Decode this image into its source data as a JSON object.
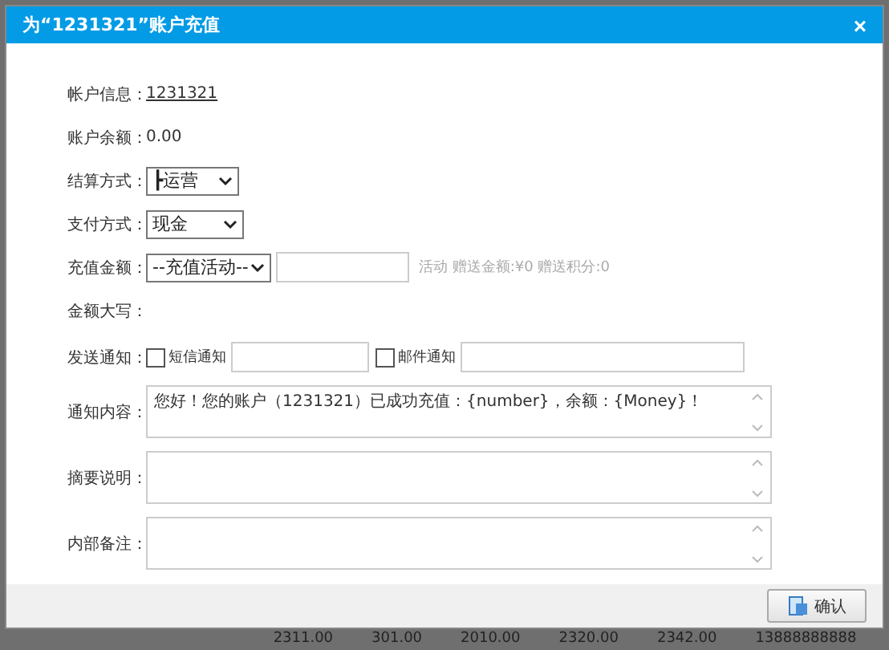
{
  "dialog": {
    "title": "为“1231321”账户充值",
    "close": "×"
  },
  "form": {
    "account_info": {
      "label": "帐户信息：",
      "value": "1231321"
    },
    "balance": {
      "label": "账户余额：",
      "value": "0.00"
    },
    "settlement": {
      "label": "结算方式：",
      "value": "┣运营"
    },
    "payment": {
      "label": "支付方式：",
      "value": "现金"
    },
    "recharge": {
      "label": "充值金额：",
      "select": "--充值活动--",
      "hint": "活动 赠送金额:¥0 赠送积分:0"
    },
    "amount_words": {
      "label": "金额大写："
    },
    "notify": {
      "label": "发送通知：",
      "options": [
        {
          "label": "短信通知",
          "checked": false
        },
        {
          "label": "邮件通知",
          "checked": false
        }
      ]
    },
    "textareas": [
      {
        "label": "通知内容：",
        "value": "您好！您的账户（1231321）已成功充值：{number}，余额：{Money}！"
      },
      {
        "label": "摘要说明："
      },
      {
        "label": "内部备注："
      }
    ]
  },
  "footer": {
    "confirm": "确认"
  },
  "background_row": [
    "2311.00",
    "301.00",
    "2010.00",
    "2320.00",
    "2342.00",
    "13888888888"
  ]
}
